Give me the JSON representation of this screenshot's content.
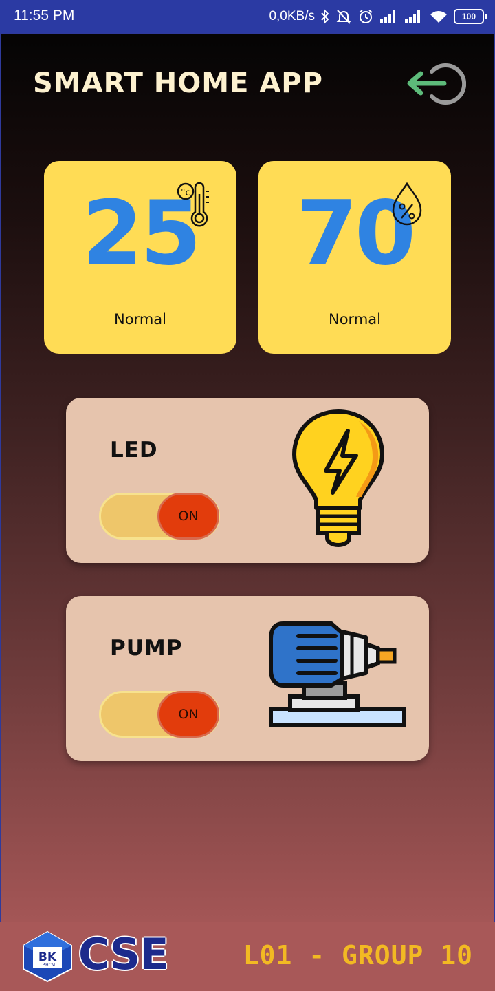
{
  "status_bar": {
    "time": "11:55 PM",
    "net_speed": "0,0KB/s",
    "battery": "100",
    "icons": [
      "bluetooth-icon",
      "mute-icon",
      "alarm-icon",
      "signal-icon",
      "signal-icon",
      "wifi-icon",
      "battery-icon"
    ]
  },
  "header": {
    "title": "SMART HOME APP",
    "logout_icon": "logout-icon",
    "logout_arrow_color": "#5dbb7a"
  },
  "sensors": [
    {
      "name": "temperature",
      "value": "25",
      "status": "Normal",
      "icon": "thermometer-celsius-icon"
    },
    {
      "name": "humidity",
      "value": "70",
      "status": "Normal",
      "icon": "humidity-drop-percent-icon"
    }
  ],
  "devices": [
    {
      "label": "LED",
      "toggle_label": "ON",
      "state": "on",
      "icon": "light-bulb-icon"
    },
    {
      "label": "PUMP",
      "toggle_label": "ON",
      "state": "on",
      "icon": "pump-motor-icon"
    }
  ],
  "footer": {
    "logo_text": "BK",
    "logo_subtext": "TP.HCM",
    "brand": "CSE",
    "group": "L01 - GROUP 10"
  },
  "colors": {
    "status_bar": "#2b3aa3",
    "sensor_card": "#ffdc55",
    "sensor_value": "#2f83e2",
    "device_card": "#e6c4ad",
    "toggle_track": "#eec66a",
    "toggle_knob": "#e23c0c",
    "footer": "#a85858",
    "group_text": "#f2b923"
  }
}
